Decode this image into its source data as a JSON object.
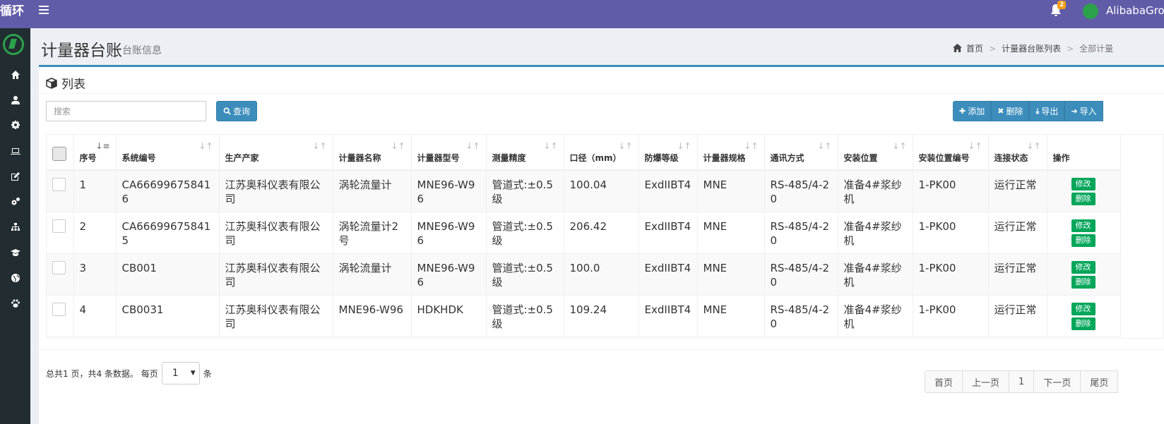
{
  "app": {
    "brand": "循环",
    "user_name": "AlibabaGroup",
    "notifications_count": "2"
  },
  "sidebar": {
    "items": [
      {
        "icon": "home-icon"
      },
      {
        "icon": "user-icon"
      },
      {
        "icon": "gear-icon"
      },
      {
        "icon": "laptop-icon"
      },
      {
        "icon": "edit-icon"
      },
      {
        "icon": "gears-icon"
      },
      {
        "icon": "sitemap-icon"
      },
      {
        "icon": "graduation-cap-icon"
      },
      {
        "icon": "globe-icon"
      },
      {
        "icon": "paw-icon"
      }
    ]
  },
  "header": {
    "title": "计量器台账",
    "subtitle": "台账信息",
    "breadcrumb": [
      "首页",
      "计量器台账列表",
      "全部计量"
    ]
  },
  "box": {
    "title": "列表",
    "search_placeholder": "搜索",
    "query_label": "查询",
    "actions": {
      "add": "添加",
      "delete": "删除",
      "export": "导出",
      "import": "导入"
    }
  },
  "table": {
    "columns": [
      "序号",
      "系统编号",
      "生产产家",
      "计量器名称",
      "计量器型号",
      "测量精度",
      "口径（mm）",
      "防爆等级",
      "计量器规格",
      "通讯方式",
      "安装位置",
      "安装位置编号",
      "连接状态",
      "操作"
    ],
    "edit_label": "修改",
    "delete_label": "删除",
    "rows": [
      {
        "no": "1",
        "code": "CA666996758416",
        "maker": "江苏奥科仪表有限公司",
        "name": "涡轮流量计",
        "model": "MNE96-W96",
        "precision": "管道式:±0.5级",
        "caliber": "100.04",
        "explosion": "ExdIIBT4",
        "spec": "MNE",
        "comm": "RS-485/4-20",
        "location": "准备4#浆纱机",
        "loc_no": "1-PK00",
        "status": "运行正常"
      },
      {
        "no": "2",
        "code": "CA666996758415",
        "maker": "江苏奥科仪表有限公司",
        "name": "涡轮流量计2号",
        "model": "MNE96-W96",
        "precision": "管道式:±0.5级",
        "caliber": "206.42",
        "explosion": "ExdIIBT4",
        "spec": "MNE",
        "comm": "RS-485/4-20",
        "location": "准备4#浆纱机",
        "loc_no": "1-PK00",
        "status": "运行正常"
      },
      {
        "no": "3",
        "code": "CB001",
        "maker": "江苏奥科仪表有限公司",
        "name": "涡轮流量计",
        "model": "MNE96-W96",
        "precision": "管道式:±0.5级",
        "caliber": "100.0",
        "explosion": "ExdIIBT4",
        "spec": "MNE",
        "comm": "RS-485/4-20",
        "location": "准备4#浆纱机",
        "loc_no": "1-PK00",
        "status": "运行正常"
      },
      {
        "no": "4",
        "code": "CB0031",
        "maker": "江苏奥科仪表有限公司",
        "name": "MNE96-W96",
        "model": "HDKHDK",
        "precision": "管道式:±0.5级",
        "caliber": "109.24",
        "explosion": "ExdIIBT4",
        "spec": "MNE",
        "comm": "RS-485/4-20",
        "location": "准备4#浆纱机",
        "loc_no": "1-PK00",
        "status": "运行正常"
      }
    ]
  },
  "pagination": {
    "summary": "总共1 页，共4 条数据。 每页",
    "page_size": "1",
    "unit": "条",
    "first": "首页",
    "prev": "上一页",
    "current": "1",
    "next": "下一页",
    "last": "尾页"
  }
}
